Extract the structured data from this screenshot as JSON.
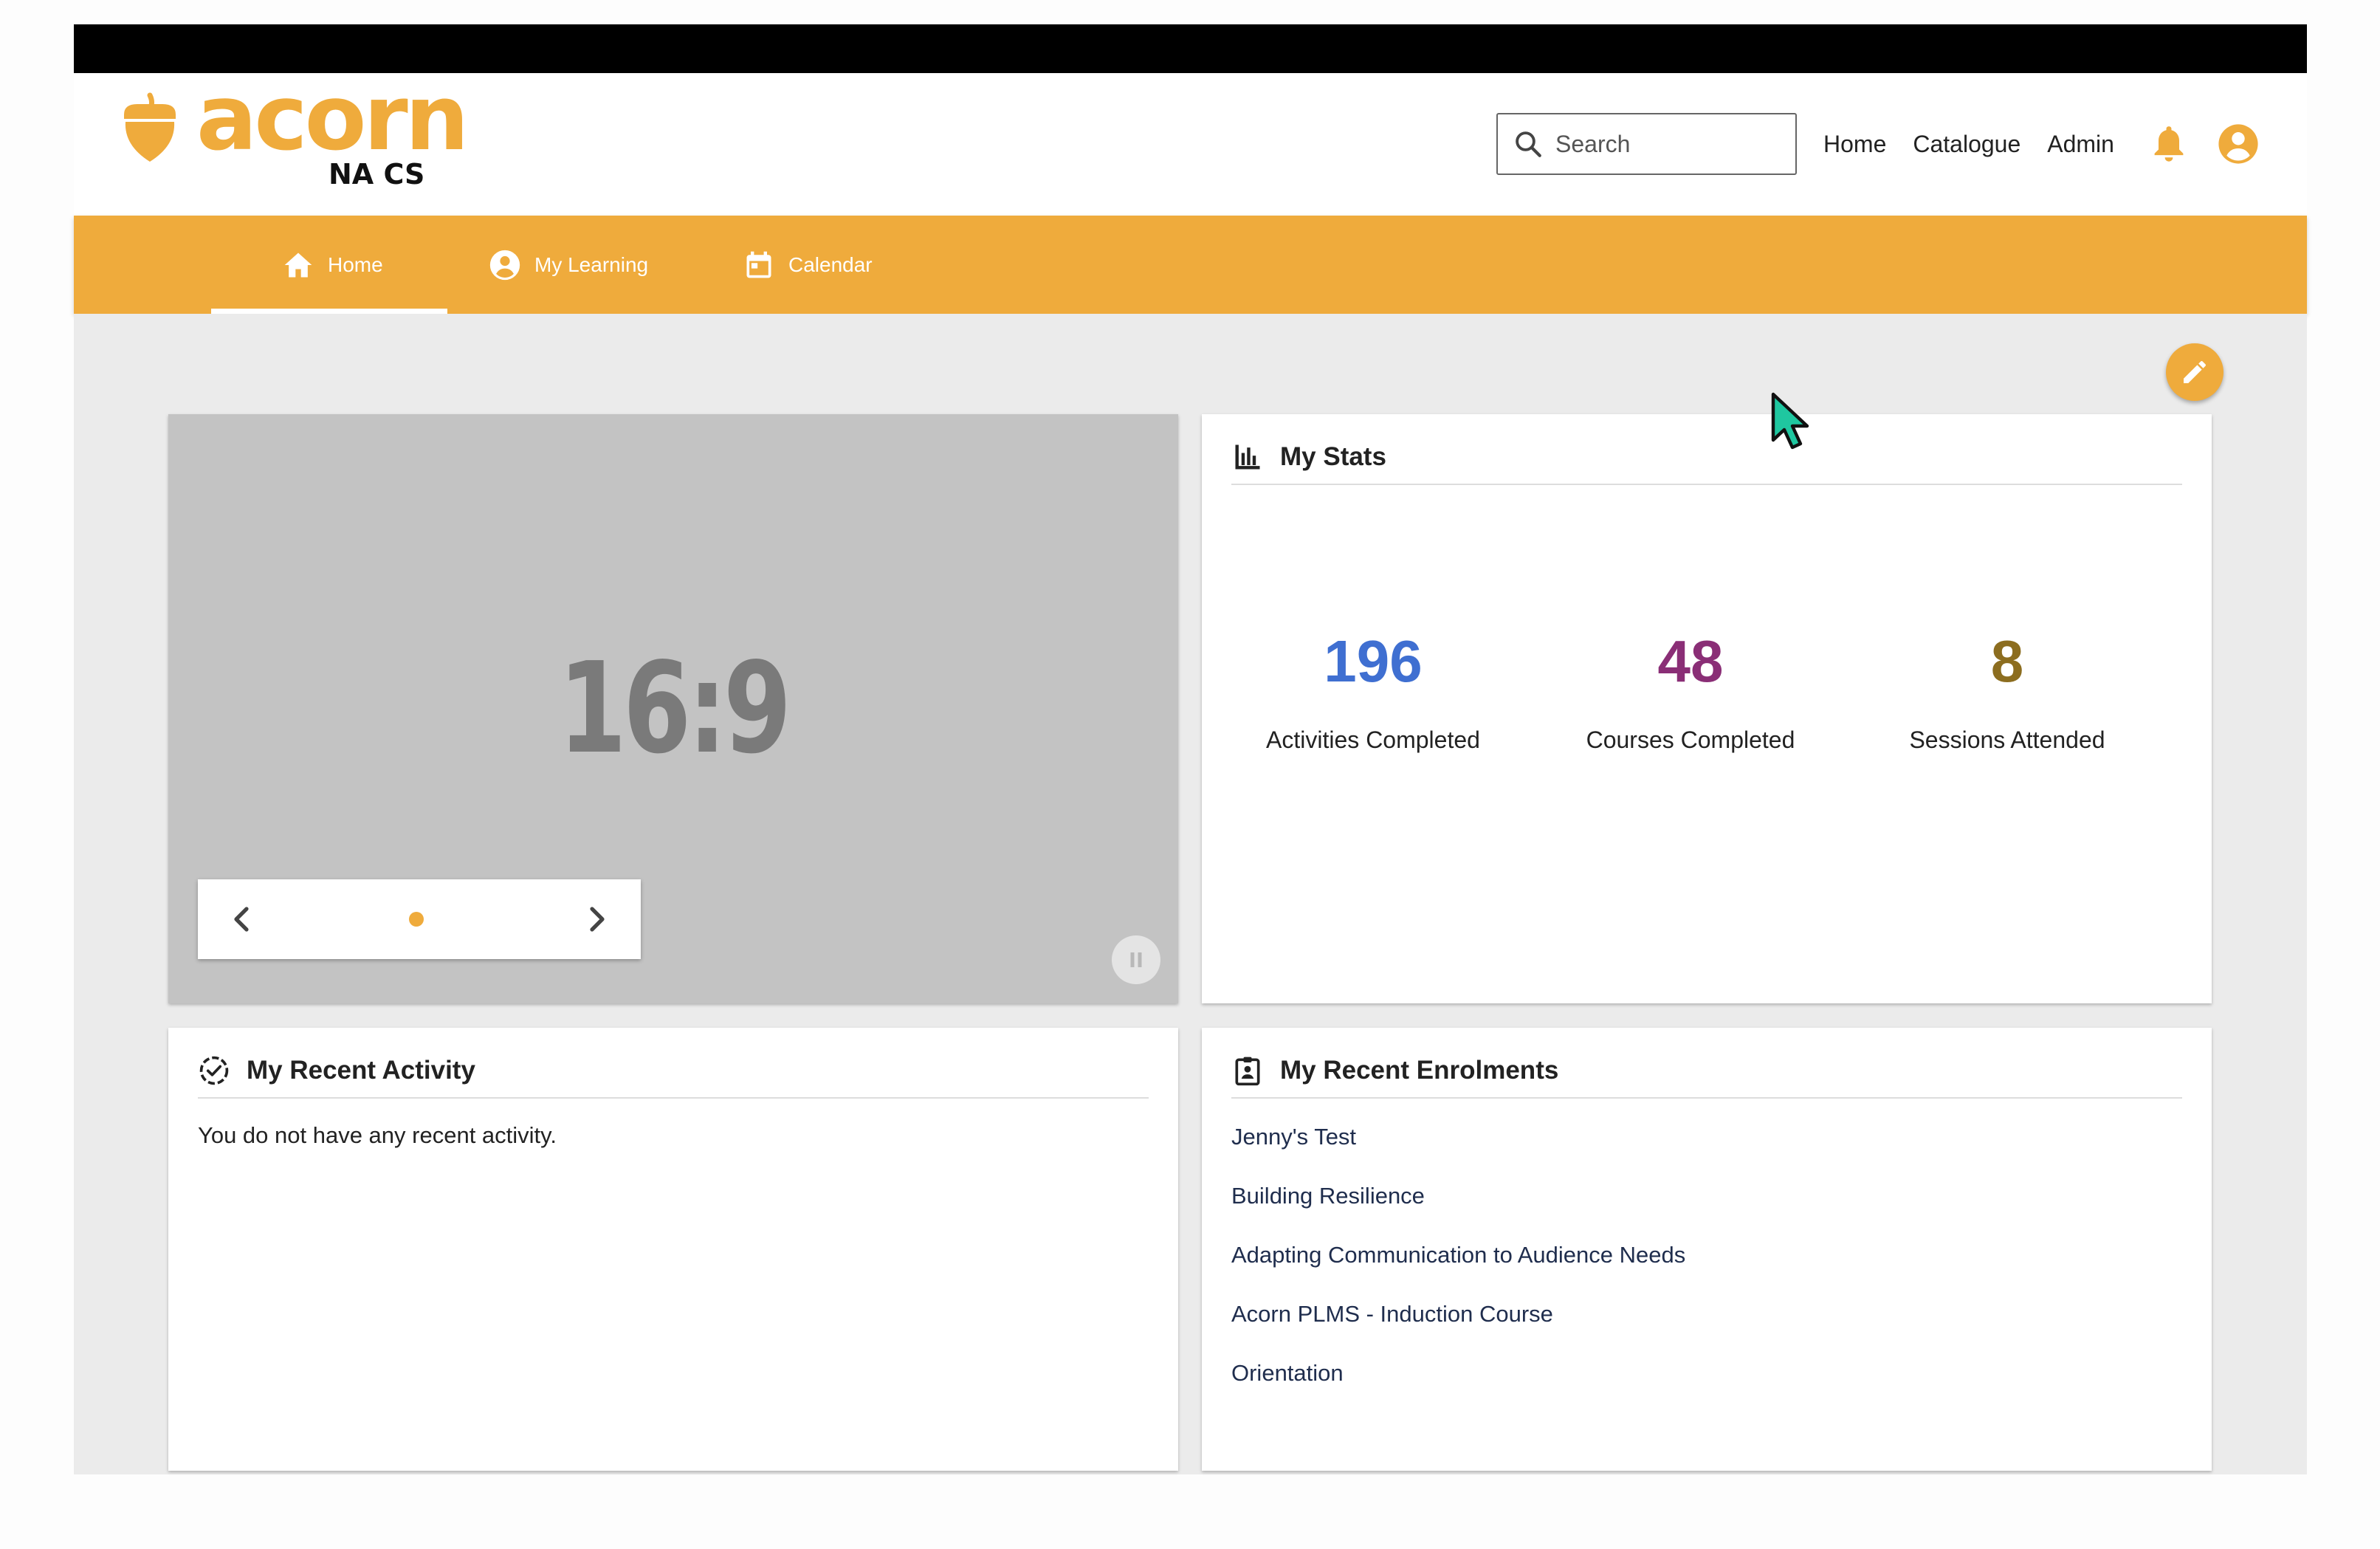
{
  "brand": {
    "logo_word": "acorn",
    "logo_sub": "NA CS",
    "color": "#efab3c"
  },
  "header": {
    "search_placeholder": "Search",
    "nav": [
      "Home",
      "Catalogue",
      "Admin"
    ],
    "icons": [
      "search-icon",
      "bell-icon",
      "account-circle-icon"
    ]
  },
  "tabs": [
    {
      "label": "Home",
      "icon": "home-icon",
      "active": true
    },
    {
      "label": "My Learning",
      "icon": "account-circle-icon",
      "active": false
    },
    {
      "label": "Calendar",
      "icon": "calendar-icon",
      "active": false
    }
  ],
  "carousel": {
    "placeholder_text": "16:9",
    "slides_count": 1,
    "current_slide": 1
  },
  "stats": {
    "title": "My Stats",
    "items": [
      {
        "value": "196",
        "label": "Activities Completed",
        "color": "#3f6fd1"
      },
      {
        "value": "48",
        "label": "Courses Completed",
        "color": "#8a2e76"
      },
      {
        "value": "8",
        "label": "Sessions Attended",
        "color": "#8c6d1f"
      }
    ]
  },
  "activity": {
    "title": "My Recent Activity",
    "empty_message": "You do not have any recent activity."
  },
  "enrolments": {
    "title": "My Recent Enrolments",
    "items": [
      "Jenny's Test",
      "Building Resilience",
      "Adapting Communication to Audience Needs",
      "Acorn PLMS - Induction Course",
      "Orientation"
    ]
  }
}
